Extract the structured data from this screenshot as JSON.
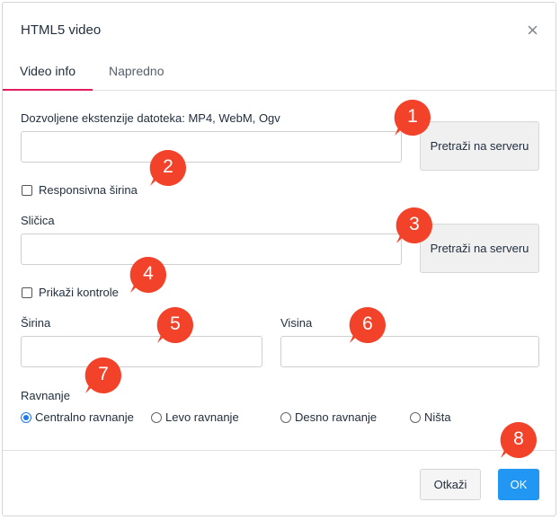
{
  "dialog": {
    "title": "HTML5 video",
    "close_icon": "close-icon"
  },
  "tabs": [
    {
      "label": "Video info",
      "active": true
    },
    {
      "label": "Napredno",
      "active": false
    }
  ],
  "form": {
    "extensions_label": "Dozvoljene ekstenzije datoteka: MP4, WebM, Ogv",
    "video_url": "",
    "browse_button_1": "Pretraži na serveru",
    "responsive_width_label": "Responsivna širina",
    "responsive_width_checked": false,
    "thumbnail_label": "Sličica",
    "thumbnail_url": "",
    "browse_button_2": "Pretraži na serveru",
    "show_controls_label": "Prikaži kontrole",
    "show_controls_checked": false,
    "width_label": "Širina",
    "width_value": "",
    "height_label": "Visina",
    "height_value": "",
    "alignment_label": "Ravnanje",
    "alignment_options": [
      {
        "label": "Centralno ravnanje",
        "selected": true
      },
      {
        "label": "Levo ravnanje",
        "selected": false
      },
      {
        "label": "Desno ravnanje",
        "selected": false
      },
      {
        "label": "Ništa",
        "selected": false
      }
    ]
  },
  "footer": {
    "cancel_label": "Otkaži",
    "ok_label": "OK"
  },
  "markers": [
    "1",
    "2",
    "3",
    "4",
    "5",
    "6",
    "7",
    "8"
  ],
  "colors": {
    "accent_tab": "#e21d5f",
    "primary_button": "#2196f3",
    "marker": "#f2432a"
  }
}
